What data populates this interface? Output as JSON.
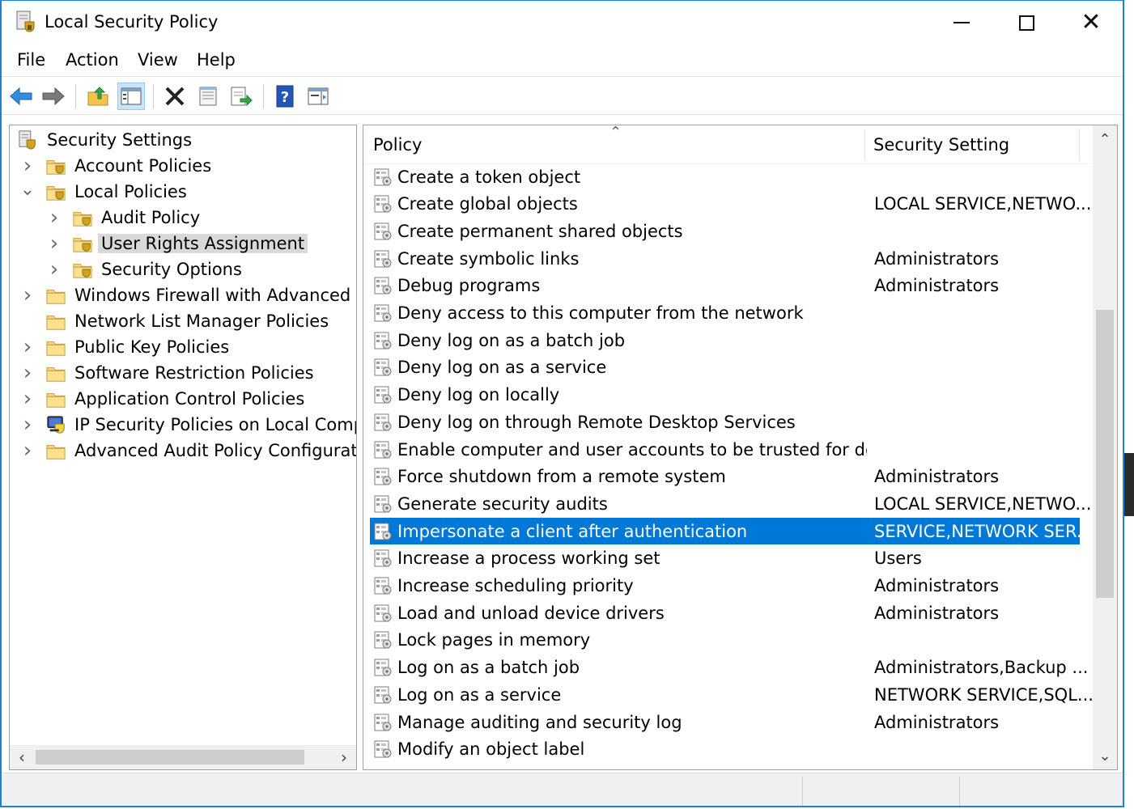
{
  "window": {
    "title": "Local Security Policy",
    "app_icon": "security-policy-icon",
    "controls": {
      "minimize_icon": "minimize-icon",
      "maximize_icon": "maximize-icon",
      "close_icon": "close-icon"
    }
  },
  "menu": [
    "File",
    "Action",
    "View",
    "Help"
  ],
  "toolbar": {
    "buttons": [
      "back-arrow-icon",
      "forward-arrow-icon",
      "up-folder-icon",
      "show-hide-tree-icon",
      "delete-icon",
      "properties-icon",
      "export-list-icon",
      "help-icon",
      "show-hide-action-pane-icon"
    ]
  },
  "tree": {
    "root": "Security Settings",
    "items": [
      {
        "label": "Account Policies",
        "level": 1,
        "expander": "collapsed",
        "icon": "secure-folder-icon"
      },
      {
        "label": "Local Policies",
        "level": 1,
        "expander": "expanded",
        "icon": "secure-folder-icon"
      },
      {
        "label": "Audit Policy",
        "level": 2,
        "expander": "collapsed",
        "icon": "secure-folder-icon"
      },
      {
        "label": "User Rights Assignment",
        "level": 2,
        "expander": "collapsed",
        "icon": "secure-folder-icon",
        "selected": true
      },
      {
        "label": "Security Options",
        "level": 2,
        "expander": "collapsed",
        "icon": "secure-folder-icon"
      },
      {
        "label": "Windows Firewall with Advanced Secu",
        "level": 1,
        "expander": "collapsed",
        "icon": "folder-icon"
      },
      {
        "label": "Network List Manager Policies",
        "level": 1,
        "expander": "none",
        "icon": "folder-icon"
      },
      {
        "label": "Public Key Policies",
        "level": 1,
        "expander": "collapsed",
        "icon": "folder-icon"
      },
      {
        "label": "Software Restriction Policies",
        "level": 1,
        "expander": "collapsed",
        "icon": "folder-icon"
      },
      {
        "label": "Application Control Policies",
        "level": 1,
        "expander": "collapsed",
        "icon": "folder-icon"
      },
      {
        "label": "IP Security Policies on Local Compute",
        "level": 1,
        "expander": "collapsed",
        "icon": "ip-security-icon"
      },
      {
        "label": "Advanced Audit Policy Configuration",
        "level": 1,
        "expander": "collapsed",
        "icon": "folder-icon"
      }
    ]
  },
  "list": {
    "columns": {
      "policy": "Policy",
      "setting": "Security Setting"
    },
    "rows": [
      {
        "policy": "Create a token object",
        "setting": ""
      },
      {
        "policy": "Create global objects",
        "setting": "LOCAL SERVICE,NETWO..."
      },
      {
        "policy": "Create permanent shared objects",
        "setting": ""
      },
      {
        "policy": "Create symbolic links",
        "setting": "Administrators"
      },
      {
        "policy": "Debug programs",
        "setting": "Administrators"
      },
      {
        "policy": "Deny access to this computer from the network",
        "setting": ""
      },
      {
        "policy": "Deny log on as a batch job",
        "setting": ""
      },
      {
        "policy": "Deny log on as a service",
        "setting": ""
      },
      {
        "policy": "Deny log on locally",
        "setting": ""
      },
      {
        "policy": "Deny log on through Remote Desktop Services",
        "setting": ""
      },
      {
        "policy": "Enable computer and user accounts to be trusted for delega...",
        "setting": ""
      },
      {
        "policy": "Force shutdown from a remote system",
        "setting": "Administrators"
      },
      {
        "policy": "Generate security audits",
        "setting": "LOCAL SERVICE,NETWO..."
      },
      {
        "policy": "Impersonate a client after authentication",
        "setting": "SERVICE,NETWORK SER...",
        "selected": true
      },
      {
        "policy": "Increase a process working set",
        "setting": "Users"
      },
      {
        "policy": "Increase scheduling priority",
        "setting": "Administrators"
      },
      {
        "policy": "Load and unload device drivers",
        "setting": "Administrators"
      },
      {
        "policy": "Lock pages in memory",
        "setting": ""
      },
      {
        "policy": "Log on as a batch job",
        "setting": "Administrators,Backup ..."
      },
      {
        "policy": "Log on as a service",
        "setting": "NETWORK SERVICE,SQL..."
      },
      {
        "policy": "Manage auditing and security log",
        "setting": "Administrators"
      },
      {
        "policy": "Modify an object label",
        "setting": ""
      }
    ]
  },
  "colors": {
    "accent": "#0078d7",
    "window_border": "#1883d7",
    "selection_gray": "#d9d9d9"
  }
}
